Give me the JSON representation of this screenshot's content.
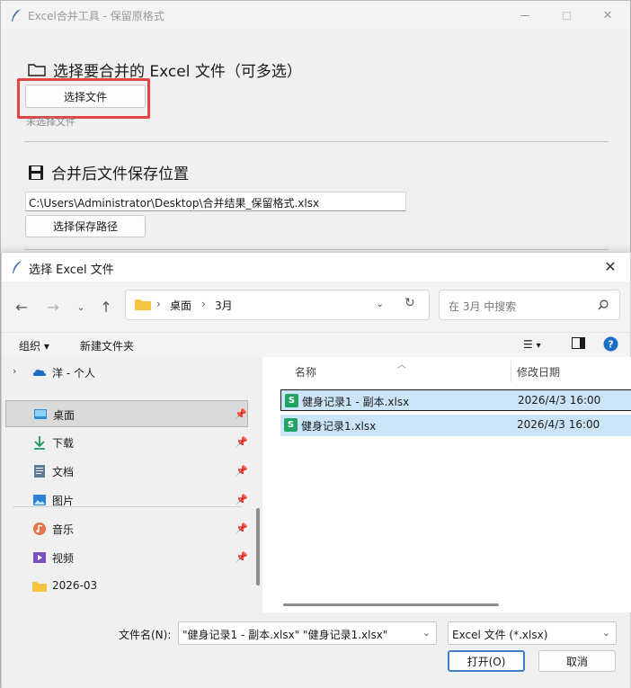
{
  "main": {
    "title": "Excel合并工具 - 保留原格式",
    "section1_title": "选择要合并的 Excel 文件（可多选）",
    "select_files_button": "选择文件",
    "no_file_hint": "未选择文件",
    "section2_title": "合并后文件保存位置",
    "save_path_value": "C:\\Users\\Administrator\\Desktop\\合并结果_保留格式.xlsx",
    "select_save_path_button": "选择保存路径",
    "highlight_color": "#e24444"
  },
  "dialog": {
    "title": "选择 Excel 文件",
    "breadcrumb": [
      "桌面",
      "3月"
    ],
    "search_placeholder": "在 3月 中搜索",
    "commands": {
      "organize": "组织",
      "new_folder": "新建文件夹"
    },
    "nav_items": [
      {
        "label": "洋 - 个人",
        "icon": "onedrive-cloud-icon"
      },
      {
        "label": "桌面",
        "icon": "desktop-icon",
        "selected": true
      },
      {
        "label": "下载",
        "icon": "download-icon"
      },
      {
        "label": "文档",
        "icon": "documents-icon"
      },
      {
        "label": "图片",
        "icon": "pictures-icon"
      },
      {
        "label": "音乐",
        "icon": "music-icon"
      },
      {
        "label": "视频",
        "icon": "videos-icon"
      },
      {
        "label": "2026-03",
        "icon": "folder-icon"
      }
    ],
    "columns": {
      "name": "名称",
      "modified": "修改日期"
    },
    "files": [
      {
        "name": "健身记录1 - 副本.xlsx",
        "modified": "2026/4/3 16:00"
      },
      {
        "name": "健身记录1.xlsx",
        "modified": "2026/4/3 16:00"
      }
    ],
    "filename_label": "文件名(N):",
    "filename_value": "\"健身记录1 - 副本.xlsx\" \"健身记录1.xlsx\"",
    "filetype_value": "Excel 文件 (*.xlsx)",
    "open_button": "打开(O)",
    "cancel_button": "取消",
    "accent_color": "#cce4f7"
  }
}
